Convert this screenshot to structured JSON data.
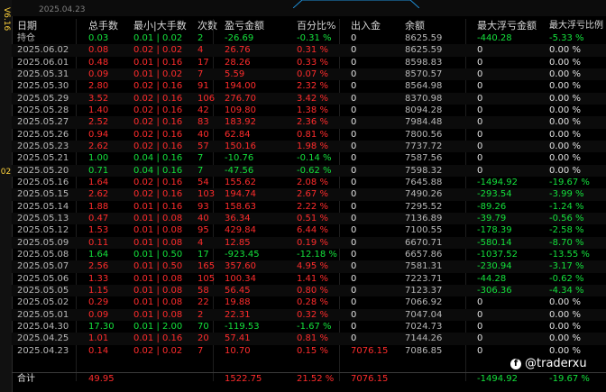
{
  "version_label": "V6.16",
  "edge_number": "02",
  "top_date": "2025.04.23",
  "headers": [
    "日期",
    "总手数",
    "最小|大手数",
    "次数",
    "盈亏金额",
    "百分比%",
    "出入金",
    "余额",
    "最大浮亏金额",
    "最大浮亏比例"
  ],
  "rows": [
    {
      "date": "持仓",
      "lots": "0.03",
      "minmax": "0.01 | 0.02",
      "count": "2",
      "pnl": "-26.69",
      "pct": "-0.31 %",
      "flow": "0",
      "balance": "8625.59",
      "maxdd": "-440.28",
      "maxddpct": "-5.33 %",
      "tone": "green"
    },
    {
      "date": "2025.06.02",
      "lots": "0.08",
      "minmax": "0.02 | 0.02",
      "count": "4",
      "pnl": "26.76",
      "pct": "0.31 %",
      "flow": "0",
      "balance": "8625.59",
      "maxdd": "0",
      "maxddpct": "0.00 %",
      "tone": "red"
    },
    {
      "date": "2025.06.01",
      "lots": "0.48",
      "minmax": "0.01 | 0.16",
      "count": "17",
      "pnl": "28.26",
      "pct": "0.33 %",
      "flow": "0",
      "balance": "8598.83",
      "maxdd": "0",
      "maxddpct": "0.00 %",
      "tone": "red"
    },
    {
      "date": "2025.05.31",
      "lots": "0.09",
      "minmax": "0.01 | 0.02",
      "count": "7",
      "pnl": "5.59",
      "pct": "0.07 %",
      "flow": "0",
      "balance": "8570.57",
      "maxdd": "0",
      "maxddpct": "0.00 %",
      "tone": "red"
    },
    {
      "date": "2025.05.30",
      "lots": "2.80",
      "minmax": "0.02 | 0.16",
      "count": "91",
      "pnl": "194.00",
      "pct": "2.32 %",
      "flow": "0",
      "balance": "8564.98",
      "maxdd": "0",
      "maxddpct": "0.00 %",
      "tone": "red"
    },
    {
      "date": "2025.05.29",
      "lots": "3.52",
      "minmax": "0.02 | 0.16",
      "count": "106",
      "pnl": "276.70",
      "pct": "3.42 %",
      "flow": "0",
      "balance": "8370.98",
      "maxdd": "0",
      "maxddpct": "0.00 %",
      "tone": "red"
    },
    {
      "date": "2025.05.28",
      "lots": "1.40",
      "minmax": "0.02 | 0.16",
      "count": "42",
      "pnl": "109.80",
      "pct": "1.38 %",
      "flow": "0",
      "balance": "8094.28",
      "maxdd": "0",
      "maxddpct": "0.00 %",
      "tone": "red"
    },
    {
      "date": "2025.05.27",
      "lots": "2.52",
      "minmax": "0.02 | 0.16",
      "count": "83",
      "pnl": "183.92",
      "pct": "2.36 %",
      "flow": "0",
      "balance": "7984.48",
      "maxdd": "0",
      "maxddpct": "0.00 %",
      "tone": "red"
    },
    {
      "date": "2025.05.26",
      "lots": "0.94",
      "minmax": "0.02 | 0.16",
      "count": "40",
      "pnl": "62.84",
      "pct": "0.81 %",
      "flow": "0",
      "balance": "7800.56",
      "maxdd": "0",
      "maxddpct": "0.00 %",
      "tone": "red"
    },
    {
      "date": "2025.05.23",
      "lots": "2.62",
      "minmax": "0.02 | 0.16",
      "count": "57",
      "pnl": "150.16",
      "pct": "1.98 %",
      "flow": "0",
      "balance": "7737.72",
      "maxdd": "0",
      "maxddpct": "0.00 %",
      "tone": "red"
    },
    {
      "date": "2025.05.21",
      "lots": "1.00",
      "minmax": "0.04 | 0.16",
      "count": "7",
      "pnl": "-10.76",
      "pct": "-0.14 %",
      "flow": "0",
      "balance": "7587.56",
      "maxdd": "0",
      "maxddpct": "0.00 %",
      "tone": "green"
    },
    {
      "date": "2025.05.20",
      "lots": "0.71",
      "minmax": "0.04 | 0.16",
      "count": "7",
      "pnl": "-47.56",
      "pct": "-0.62 %",
      "flow": "0",
      "balance": "7598.32",
      "maxdd": "0",
      "maxddpct": "0.00 %",
      "tone": "green"
    },
    {
      "date": "2025.05.16",
      "lots": "1.64",
      "minmax": "0.02 | 0.16",
      "count": "54",
      "pnl": "155.62",
      "pct": "2.08 %",
      "flow": "0",
      "balance": "7645.88",
      "maxdd": "-1494.92",
      "maxddpct": "-19.67 %",
      "tone": "red"
    },
    {
      "date": "2025.05.15",
      "lots": "2.62",
      "minmax": "0.02 | 0.16",
      "count": "103",
      "pnl": "194.74",
      "pct": "2.67 %",
      "flow": "0",
      "balance": "7490.26",
      "maxdd": "-293.54",
      "maxddpct": "-3.99 %",
      "tone": "red"
    },
    {
      "date": "2025.05.14",
      "lots": "1.88",
      "minmax": "0.01 | 0.16",
      "count": "93",
      "pnl": "158.63",
      "pct": "2.22 %",
      "flow": "0",
      "balance": "7295.52",
      "maxdd": "-89.26",
      "maxddpct": "-1.24 %",
      "tone": "red"
    },
    {
      "date": "2025.05.13",
      "lots": "0.47",
      "minmax": "0.01 | 0.08",
      "count": "40",
      "pnl": "36.34",
      "pct": "0.51 %",
      "flow": "0",
      "balance": "7136.89",
      "maxdd": "-39.79",
      "maxddpct": "-0.56 %",
      "tone": "red"
    },
    {
      "date": "2025.05.12",
      "lots": "1.53",
      "minmax": "0.01 | 0.08",
      "count": "95",
      "pnl": "429.84",
      "pct": "6.44 %",
      "flow": "0",
      "balance": "7100.55",
      "maxdd": "-178.39",
      "maxddpct": "-2.58 %",
      "tone": "red"
    },
    {
      "date": "2025.05.09",
      "lots": "0.11",
      "minmax": "0.01 | 0.08",
      "count": "4",
      "pnl": "12.85",
      "pct": "0.19 %",
      "flow": "0",
      "balance": "6670.71",
      "maxdd": "-580.14",
      "maxddpct": "-8.70 %",
      "tone": "red"
    },
    {
      "date": "2025.05.08",
      "lots": "1.64",
      "minmax": "0.01 | 0.50",
      "count": "17",
      "pnl": "-923.45",
      "pct": "-12.18 %",
      "flow": "0",
      "balance": "6657.86",
      "maxdd": "-1037.52",
      "maxddpct": "-13.55 %",
      "tone": "green"
    },
    {
      "date": "2025.05.07",
      "lots": "2.56",
      "minmax": "0.01 | 0.50",
      "count": "165",
      "pnl": "357.60",
      "pct": "4.95 %",
      "flow": "0",
      "balance": "7581.31",
      "maxdd": "-230.94",
      "maxddpct": "-3.17 %",
      "tone": "red"
    },
    {
      "date": "2025.05.06",
      "lots": "1.33",
      "minmax": "0.01 | 0.08",
      "count": "105",
      "pnl": "100.34",
      "pct": "1.41 %",
      "flow": "0",
      "balance": "7223.71",
      "maxdd": "-44.28",
      "maxddpct": "-0.62 %",
      "tone": "red"
    },
    {
      "date": "2025.05.05",
      "lots": "1.15",
      "minmax": "0.01 | 0.08",
      "count": "58",
      "pnl": "56.45",
      "pct": "0.80 %",
      "flow": "0",
      "balance": "7123.37",
      "maxdd": "-306.36",
      "maxddpct": "-4.34 %",
      "tone": "red"
    },
    {
      "date": "2025.05.02",
      "lots": "0.29",
      "minmax": "0.01 | 0.08",
      "count": "22",
      "pnl": "19.88",
      "pct": "0.28 %",
      "flow": "0",
      "balance": "7066.92",
      "maxdd": "0",
      "maxddpct": "0.00 %",
      "tone": "red"
    },
    {
      "date": "2025.05.01",
      "lots": "0.09",
      "minmax": "0.01 | 0.08",
      "count": "2",
      "pnl": "22.31",
      "pct": "0.32 %",
      "flow": "0",
      "balance": "7047.04",
      "maxdd": "0",
      "maxddpct": "0.00 %",
      "tone": "red"
    },
    {
      "date": "2025.04.30",
      "lots": "17.30",
      "minmax": "0.01 | 2.00",
      "count": "70",
      "pnl": "-119.53",
      "pct": "-1.67 %",
      "flow": "0",
      "balance": "7024.73",
      "maxdd": "0",
      "maxddpct": "0.00 %",
      "tone": "green"
    },
    {
      "date": "2025.04.25",
      "lots": "1.01",
      "minmax": "0.01 | 0.16",
      "count": "20",
      "pnl": "57.41",
      "pct": "0.81 %",
      "flow": "0",
      "balance": "7144.26",
      "maxdd": "0",
      "maxddpct": "0.00 %",
      "tone": "red"
    },
    {
      "date": "2025.04.23",
      "lots": "0.14",
      "minmax": "0.02 | 0.02",
      "count": "7",
      "pnl": "10.70",
      "pct": "0.15 %",
      "flow": "7076.15",
      "balance": "7086.85",
      "maxdd": "0",
      "maxddpct": "0.00 %",
      "tone": "red"
    }
  ],
  "total": {
    "label": "合计",
    "lots": "49.95",
    "pnl": "1522.75",
    "pct": "21.52 %",
    "flow": "7076.15",
    "maxdd": "-1494.92",
    "maxddpct": "-19.67 %"
  },
  "watermark": "@traderxu",
  "watermark_icon": "facebook-icon",
  "colors": {
    "profit": "#ff2c2c",
    "loss": "#14e13c",
    "neutral": "#e0e0e0",
    "background": "#000000",
    "accent": "#ffd23c"
  }
}
